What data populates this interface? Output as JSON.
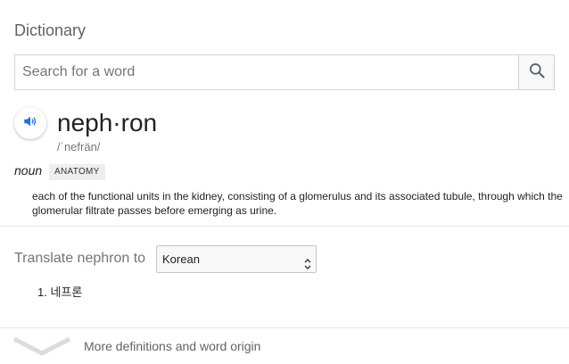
{
  "dictionary": {
    "title": "Dictionary",
    "search": {
      "placeholder": "Search for a word",
      "value": "",
      "icon": "search-icon"
    },
    "entry": {
      "speaker_icon": "speaker-icon",
      "headword": "neph·ron",
      "phonetic": "/ˈnefrän/",
      "part_of_speech": "noun",
      "tag": "ANATOMY",
      "definition": "each of the functional units in the kidney, consisting of a glomerulus and its associated tubule, through which the glomerular filtrate passes before emerging as urine."
    },
    "translate": {
      "label": "Translate nephron to",
      "selected_language": "Korean",
      "results": [
        {
          "number": "1.",
          "text": "네프론"
        }
      ]
    },
    "more": {
      "label": "More definitions and word origin",
      "icon": "chevron-down-icon"
    }
  },
  "colors": {
    "accent_blue": "#1a73e8",
    "muted_text": "#70757a",
    "divider": "#e8e8e8"
  }
}
